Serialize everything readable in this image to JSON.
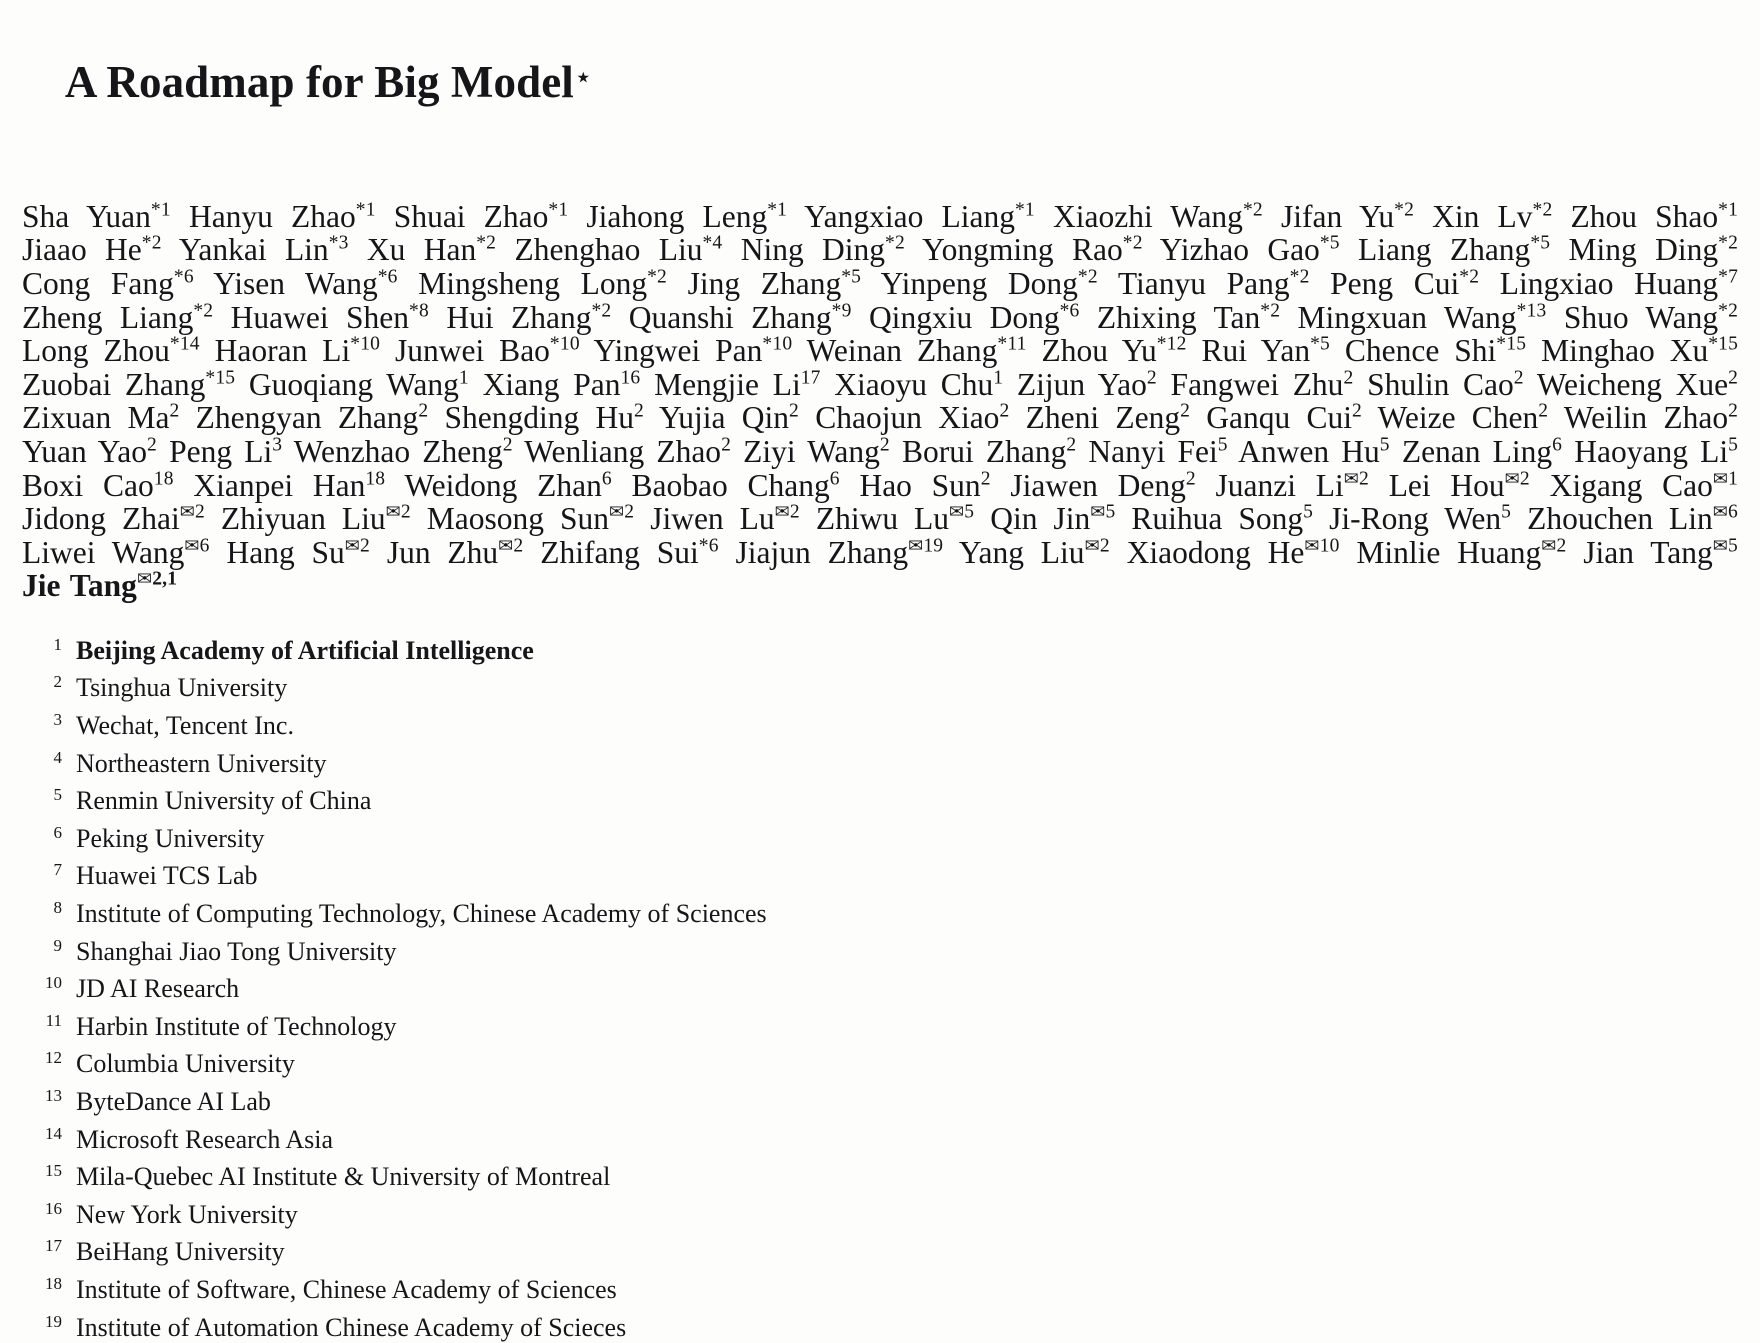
{
  "title": {
    "text": "A Roadmap for Big Model",
    "footnote_marker": "⋆"
  },
  "authors": [
    {
      "name": "Sha Yuan",
      "sup": "*1"
    },
    {
      "name": "Hanyu Zhao",
      "sup": "*1"
    },
    {
      "name": "Shuai Zhao",
      "sup": "*1"
    },
    {
      "name": "Jiahong Leng",
      "sup": "*1"
    },
    {
      "name": "Yangxiao Liang",
      "sup": "*1"
    },
    {
      "name": "Xiaozhi Wang",
      "sup": "*2"
    },
    {
      "name": "Jifan Yu",
      "sup": "*2"
    },
    {
      "name": "Xin Lv",
      "sup": "*2"
    },
    {
      "name": "Zhou Shao",
      "sup": "*1"
    },
    {
      "name": "Jiaao He",
      "sup": "*2"
    },
    {
      "name": "Yankai Lin",
      "sup": "*3"
    },
    {
      "name": "Xu Han",
      "sup": "*2"
    },
    {
      "name": "Zhenghao Liu",
      "sup": "*4"
    },
    {
      "name": "Ning Ding",
      "sup": "*2"
    },
    {
      "name": "Yongming Rao",
      "sup": "*2"
    },
    {
      "name": "Yizhao Gao",
      "sup": "*5"
    },
    {
      "name": "Liang Zhang",
      "sup": "*5"
    },
    {
      "name": "Ming Ding",
      "sup": "*2"
    },
    {
      "name": "Cong Fang",
      "sup": "*6"
    },
    {
      "name": "Yisen Wang",
      "sup": "*6"
    },
    {
      "name": "Mingsheng Long",
      "sup": "*2"
    },
    {
      "name": "Jing Zhang",
      "sup": "*5"
    },
    {
      "name": "Yinpeng Dong",
      "sup": "*2"
    },
    {
      "name": "Tianyu Pang",
      "sup": "*2"
    },
    {
      "name": "Peng Cui",
      "sup": "*2"
    },
    {
      "name": "Lingxiao Huang",
      "sup": "*7"
    },
    {
      "name": "Zheng Liang",
      "sup": "*2"
    },
    {
      "name": "Huawei Shen",
      "sup": "*8"
    },
    {
      "name": "Hui Zhang",
      "sup": "*2"
    },
    {
      "name": "Quanshi Zhang",
      "sup": "*9"
    },
    {
      "name": "Qingxiu Dong",
      "sup": "*6"
    },
    {
      "name": "Zhixing Tan",
      "sup": "*2"
    },
    {
      "name": "Mingxuan Wang",
      "sup": "*13"
    },
    {
      "name": "Shuo Wang",
      "sup": "*2"
    },
    {
      "name": "Long Zhou",
      "sup": "*14"
    },
    {
      "name": "Haoran Li",
      "sup": "*10"
    },
    {
      "name": "Junwei Bao",
      "sup": "*10"
    },
    {
      "name": "Yingwei Pan",
      "sup": "*10"
    },
    {
      "name": "Weinan Zhang",
      "sup": "*11"
    },
    {
      "name": "Zhou Yu",
      "sup": "*12"
    },
    {
      "name": "Rui Yan",
      "sup": "*5"
    },
    {
      "name": "Chence Shi",
      "sup": "*15"
    },
    {
      "name": "Minghao Xu",
      "sup": "*15"
    },
    {
      "name": "Zuobai Zhang",
      "sup": "*15"
    },
    {
      "name": "Guoqiang Wang",
      "sup": "1"
    },
    {
      "name": "Xiang Pan",
      "sup": "16"
    },
    {
      "name": "Mengjie Li",
      "sup": "17"
    },
    {
      "name": "Xiaoyu Chu",
      "sup": "1"
    },
    {
      "name": "Zijun Yao",
      "sup": "2"
    },
    {
      "name": "Fangwei Zhu",
      "sup": "2"
    },
    {
      "name": "Shulin Cao",
      "sup": "2"
    },
    {
      "name": "Weicheng Xue",
      "sup": "2"
    },
    {
      "name": "Zixuan Ma",
      "sup": "2"
    },
    {
      "name": "Zhengyan Zhang",
      "sup": "2"
    },
    {
      "name": "Shengding Hu",
      "sup": "2"
    },
    {
      "name": "Yujia Qin",
      "sup": "2"
    },
    {
      "name": "Chaojun Xiao",
      "sup": "2"
    },
    {
      "name": "Zheni Zeng",
      "sup": "2"
    },
    {
      "name": "Ganqu Cui",
      "sup": "2"
    },
    {
      "name": "Weize Chen",
      "sup": "2"
    },
    {
      "name": "Weilin Zhao",
      "sup": "2"
    },
    {
      "name": "Yuan Yao",
      "sup": "2"
    },
    {
      "name": "Peng Li",
      "sup": "3"
    },
    {
      "name": "Wenzhao Zheng",
      "sup": "2"
    },
    {
      "name": "Wenliang Zhao",
      "sup": "2"
    },
    {
      "name": "Ziyi Wang",
      "sup": "2"
    },
    {
      "name": "Borui Zhang",
      "sup": "2"
    },
    {
      "name": "Nanyi Fei",
      "sup": "5"
    },
    {
      "name": "Anwen Hu",
      "sup": "5"
    },
    {
      "name": "Zenan Ling",
      "sup": "6"
    },
    {
      "name": "Haoyang Li",
      "sup": "5"
    },
    {
      "name": "Boxi Cao",
      "sup": "18"
    },
    {
      "name": "Xianpei Han",
      "sup": "18"
    },
    {
      "name": "Weidong Zhan",
      "sup": "6"
    },
    {
      "name": "Baobao Chang",
      "sup": "6"
    },
    {
      "name": "Hao Sun",
      "sup": "2"
    },
    {
      "name": "Jiawen Deng",
      "sup": "2"
    },
    {
      "name": "Juanzi Li",
      "sup": "✉2"
    },
    {
      "name": "Lei Hou",
      "sup": "✉2"
    },
    {
      "name": "Xigang Cao",
      "sup": "✉1"
    },
    {
      "name": "Jidong Zhai",
      "sup": "✉2"
    },
    {
      "name": "Zhiyuan Liu",
      "sup": "✉2"
    },
    {
      "name": "Maosong Sun",
      "sup": "✉2"
    },
    {
      "name": "Jiwen Lu",
      "sup": "✉2"
    },
    {
      "name": "Zhiwu Lu",
      "sup": "✉5"
    },
    {
      "name": "Qin Jin",
      "sup": "✉5"
    },
    {
      "name": "Ruihua Song",
      "sup": "5"
    },
    {
      "name": "Ji-Rong Wen",
      "sup": "5"
    },
    {
      "name": "Zhouchen Lin",
      "sup": "✉6"
    },
    {
      "name": "Liwei Wang",
      "sup": "✉6"
    },
    {
      "name": "Hang Su",
      "sup": "✉2"
    },
    {
      "name": "Jun Zhu",
      "sup": "✉2"
    },
    {
      "name": "Zhifang Sui",
      "sup": "*6"
    },
    {
      "name": "Jiajun Zhang",
      "sup": "✉19"
    },
    {
      "name": "Yang Liu",
      "sup": "✉2"
    },
    {
      "name": "Xiaodong He",
      "sup": "✉10"
    },
    {
      "name": "Minlie Huang",
      "sup": "✉2"
    },
    {
      "name": "Jian Tang",
      "sup": "✉5"
    },
    {
      "name": "Jie Tang",
      "sup": "✉2,1",
      "bold": true
    }
  ],
  "affiliations": [
    {
      "num": "1",
      "name": "Beijing Academy of Artificial Intelligence",
      "bold": true
    },
    {
      "num": "2",
      "name": "Tsinghua University"
    },
    {
      "num": "3",
      "name": "Wechat, Tencent Inc."
    },
    {
      "num": "4",
      "name": "Northeastern University"
    },
    {
      "num": "5",
      "name": "Renmin University of China"
    },
    {
      "num": "6",
      "name": "Peking University"
    },
    {
      "num": "7",
      "name": "Huawei TCS Lab"
    },
    {
      "num": "8",
      "name": "Institute of Computing Technology, Chinese Academy of Sciences"
    },
    {
      "num": "9",
      "name": "Shanghai Jiao Tong University"
    },
    {
      "num": "10",
      "name": "JD AI Research"
    },
    {
      "num": "11",
      "name": "Harbin Institute of Technology"
    },
    {
      "num": "12",
      "name": "Columbia University"
    },
    {
      "num": "13",
      "name": "ByteDance AI Lab"
    },
    {
      "num": "14",
      "name": "Microsoft Research Asia"
    },
    {
      "num": "15",
      "name": "Mila-Quebec AI Institute & University of Montreal"
    },
    {
      "num": "16",
      "name": "New York University"
    },
    {
      "num": "17",
      "name": "BeiHang University"
    },
    {
      "num": "18",
      "name": "Institute of Software, Chinese Academy of Sciences"
    },
    {
      "num": "19",
      "name": "Institute of Automation Chinese Academy of Scieces"
    }
  ],
  "colors": {
    "page_background": "#fdfdfb",
    "text": "#16161a"
  }
}
